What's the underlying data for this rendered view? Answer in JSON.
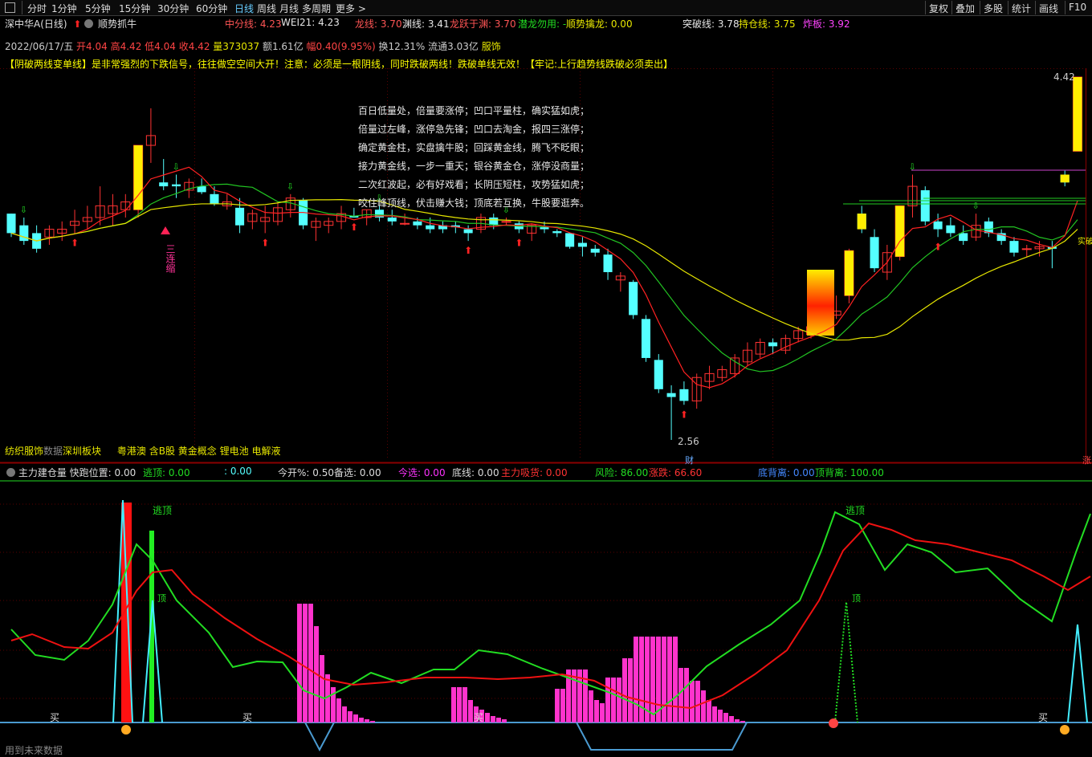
{
  "topbar": {
    "tabs": [
      "分时",
      "1分钟",
      "5分钟",
      "15分钟",
      "30分钟",
      "60分钟",
      "日线",
      "周线",
      "月线",
      "多周期",
      "更多 >"
    ],
    "active_tab": "日线",
    "right_buttons": [
      "复权",
      "叠加",
      "多股",
      "统计",
      "画线",
      "F10"
    ]
  },
  "header": {
    "stock_name": "深中华A(日线)",
    "indicator_name": "顺势抓牛",
    "zhongfen": "中分线: 4.23",
    "wei21": "WEI21: 4.23",
    "longxian": "龙线: 3.70",
    "yuanxian": "渊线: 3.41",
    "longyue": "龙跃于渊: 3.70",
    "qianlong": "潜龙勿用: -",
    "shunshi": "顺势擒龙: 0.00",
    "tupo": "突破线: 3.78",
    "chicang": "持仓线: 3.75",
    "zhaban": "炸板: 3.92"
  },
  "quote": {
    "date": "2022/06/17/五",
    "open": "开4.04",
    "high": "高4.42",
    "low": "低4.04",
    "close": "收4.42",
    "volume": "量373037",
    "amount": "额1.61亿",
    "change": "幅0.40(9.95%)",
    "turnover": "换12.31%",
    "float": "流通3.03亿",
    "industry": "服饰"
  },
  "warning": "【阴破两线变单线】是非常强烈的下跌信号，往往做空空间大开！注意：必须是一根阴线，同时跌破两线！跌破单线无效！【牢记:上行趋势线跌破必须卖出】",
  "poem": [
    "百日低量处，倍量要涨停；凹口平量柱，确实猛如虎；",
    "倍量过左峰，涨停急先锋；凹口去淘金，报四三涨停；",
    "确定黄金柱，实盘擒牛股；回踩黄金线，腾飞不眨眼；",
    "接力黄金线，一步一重天；银谷黄金仓，涨停没商量；",
    "二次红波起，必有好戏看；长阴压短柱，攻势猛如虎；",
    "咬住峰顶线，伏击赚大钱；顶底若互换，牛股要逛奔。"
  ],
  "sectors": {
    "a": "纺织服饰",
    "b": "数据",
    "c": "深圳板块",
    "d": "粤港澳",
    "e": "含B股",
    "f": "黄金概念",
    "g": "锂电池",
    "h": "电解液"
  },
  "labels": {
    "high_price": "4.42",
    "low_price": "2.56",
    "pattern_text": "三连缩",
    "cai": "财",
    "bot_right": "涨",
    "hot_label": "实破"
  },
  "indicator": {
    "name": "主力建仓量",
    "kuaipao": "快跑位置: 0.00",
    "taoding": "逃顶: 0.00",
    "blank": ": 0.00",
    "jinkai": "今开%: 0.50",
    "beixuan": "备选: 0.00",
    "jinxuan": "今选: 0.00",
    "dixian": "底线: 0.00",
    "zhuli": "主力吸货: 0.00",
    "fengxian": "风险: 86.00",
    "zhangdie": "涨跌: 66.60",
    "dibeili": "底背离: 0.00",
    "dingbeili": "顶背离: 100.00",
    "lbl_taoding": "逃顶",
    "lbl_ding": "顶",
    "lbl_mai": "买"
  },
  "footer": "用到未来数据",
  "colors": {
    "up": "#ff3232",
    "down": "#54ffff",
    "ma_yellow": "#e6e600",
    "ma_green": "#22c322",
    "pink": "#ff33cc",
    "kdj_green": "#22dd22",
    "kdj_red": "#ee1111"
  },
  "chart_data": {
    "type": "candlestick",
    "price_range": [
      2.56,
      4.42
    ],
    "candles": [
      {
        "o": 3.72,
        "h": 3.72,
        "l": 3.6,
        "c": 3.62
      },
      {
        "o": 3.66,
        "h": 3.7,
        "l": 3.56,
        "c": 3.58
      },
      {
        "o": 3.62,
        "h": 3.66,
        "l": 3.52,
        "c": 3.54
      },
      {
        "o": 3.6,
        "h": 3.66,
        "l": 3.56,
        "c": 3.64
      },
      {
        "o": 3.62,
        "h": 3.68,
        "l": 3.58,
        "c": 3.64
      },
      {
        "o": 3.66,
        "h": 3.74,
        "l": 3.62,
        "c": 3.68
      },
      {
        "o": 3.68,
        "h": 3.76,
        "l": 3.64,
        "c": 3.7
      },
      {
        "o": 3.7,
        "h": 3.86,
        "l": 3.66,
        "c": 3.76
      },
      {
        "o": 3.72,
        "h": 3.82,
        "l": 3.66,
        "c": 3.76
      },
      {
        "o": 3.74,
        "h": 3.82,
        "l": 3.7,
        "c": 3.78
      },
      {
        "o": 3.74,
        "h": 4.07,
        "l": 3.7,
        "c": 4.07
      },
      {
        "o": 4.07,
        "h": 4.26,
        "l": 3.98,
        "c": 4.12
      },
      {
        "o": 3.88,
        "h": 4.0,
        "l": 3.84,
        "c": 3.86
      },
      {
        "o": 3.87,
        "h": 3.92,
        "l": 3.8,
        "c": 3.86
      },
      {
        "o": 3.84,
        "h": 3.9,
        "l": 3.8,
        "c": 3.88
      },
      {
        "o": 3.86,
        "h": 3.9,
        "l": 3.82,
        "c": 3.83
      },
      {
        "o": 3.82,
        "h": 3.86,
        "l": 3.76,
        "c": 3.77
      },
      {
        "o": 3.76,
        "h": 3.82,
        "l": 3.74,
        "c": 3.78
      },
      {
        "o": 3.75,
        "h": 3.8,
        "l": 3.62,
        "c": 3.66
      },
      {
        "o": 3.68,
        "h": 3.74,
        "l": 3.64,
        "c": 3.72
      },
      {
        "o": 3.68,
        "h": 3.76,
        "l": 3.62,
        "c": 3.7
      },
      {
        "o": 3.68,
        "h": 3.78,
        "l": 3.66,
        "c": 3.75
      },
      {
        "o": 3.74,
        "h": 3.82,
        "l": 3.7,
        "c": 3.8
      },
      {
        "o": 3.79,
        "h": 3.8,
        "l": 3.64,
        "c": 3.66
      },
      {
        "o": 3.65,
        "h": 3.7,
        "l": 3.58,
        "c": 3.68
      },
      {
        "o": 3.66,
        "h": 3.7,
        "l": 3.62,
        "c": 3.68
      },
      {
        "o": 3.68,
        "h": 3.76,
        "l": 3.64,
        "c": 3.72
      },
      {
        "o": 3.71,
        "h": 3.75,
        "l": 3.7,
        "c": 3.7
      },
      {
        "o": 3.7,
        "h": 3.74,
        "l": 3.66,
        "c": 3.74
      },
      {
        "o": 3.74,
        "h": 3.76,
        "l": 3.68,
        "c": 3.7
      },
      {
        "o": 3.7,
        "h": 3.74,
        "l": 3.66,
        "c": 3.68
      },
      {
        "o": 3.67,
        "h": 3.72,
        "l": 3.66,
        "c": 3.67
      },
      {
        "o": 3.68,
        "h": 3.7,
        "l": 3.64,
        "c": 3.66
      },
      {
        "o": 3.66,
        "h": 3.7,
        "l": 3.62,
        "c": 3.64
      },
      {
        "o": 3.66,
        "h": 3.68,
        "l": 3.62,
        "c": 3.64
      },
      {
        "o": 3.66,
        "h": 3.68,
        "l": 3.62,
        "c": 3.65
      },
      {
        "o": 3.64,
        "h": 3.66,
        "l": 3.58,
        "c": 3.62
      },
      {
        "o": 3.64,
        "h": 3.72,
        "l": 3.62,
        "c": 3.7
      },
      {
        "o": 3.7,
        "h": 3.72,
        "l": 3.64,
        "c": 3.66
      },
      {
        "o": 3.68,
        "h": 3.7,
        "l": 3.66,
        "c": 3.68
      },
      {
        "o": 3.67,
        "h": 3.68,
        "l": 3.62,
        "c": 3.64
      },
      {
        "o": 3.62,
        "h": 3.67,
        "l": 3.58,
        "c": 3.66
      },
      {
        "o": 3.65,
        "h": 3.68,
        "l": 3.62,
        "c": 3.64
      },
      {
        "o": 3.63,
        "h": 3.64,
        "l": 3.6,
        "c": 3.62
      },
      {
        "o": 3.62,
        "h": 3.62,
        "l": 3.54,
        "c": 3.55
      },
      {
        "o": 3.57,
        "h": 3.6,
        "l": 3.5,
        "c": 3.55
      },
      {
        "o": 3.54,
        "h": 3.56,
        "l": 3.5,
        "c": 3.52
      },
      {
        "o": 3.51,
        "h": 3.54,
        "l": 3.38,
        "c": 3.42
      },
      {
        "o": 3.38,
        "h": 3.42,
        "l": 3.32,
        "c": 3.4
      },
      {
        "o": 3.37,
        "h": 3.38,
        "l": 3.18,
        "c": 3.2
      },
      {
        "o": 3.18,
        "h": 3.2,
        "l": 2.96,
        "c": 2.98
      },
      {
        "o": 2.97,
        "h": 3.0,
        "l": 2.8,
        "c": 2.82
      },
      {
        "o": 2.8,
        "h": 2.84,
        "l": 2.56,
        "c": 2.78
      },
      {
        "o": 2.82,
        "h": 2.86,
        "l": 2.74,
        "c": 2.76
      },
      {
        "o": 2.76,
        "h": 2.9,
        "l": 2.72,
        "c": 2.88
      },
      {
        "o": 2.86,
        "h": 2.94,
        "l": 2.82,
        "c": 2.9
      },
      {
        "o": 2.88,
        "h": 2.94,
        "l": 2.86,
        "c": 2.92
      },
      {
        "o": 2.9,
        "h": 3.0,
        "l": 2.88,
        "c": 2.98
      },
      {
        "o": 2.96,
        "h": 3.06,
        "l": 2.94,
        "c": 3.02
      },
      {
        "o": 3.0,
        "h": 3.08,
        "l": 2.98,
        "c": 3.06
      },
      {
        "o": 3.06,
        "h": 3.08,
        "l": 3.0,
        "c": 3.04
      },
      {
        "o": 3.02,
        "h": 3.1,
        "l": 3.0,
        "c": 3.08
      },
      {
        "o": 3.08,
        "h": 3.14,
        "l": 3.06,
        "c": 3.12
      },
      {
        "o": 3.1,
        "h": 3.18,
        "l": 3.08,
        "c": 3.14
      },
      {
        "o": 3.14,
        "h": 3.22,
        "l": 3.12,
        "c": 3.2
      },
      {
        "o": 3.2,
        "h": 3.3,
        "l": 3.18,
        "c": 3.22
      },
      {
        "o": 3.3,
        "h": 3.54,
        "l": 3.26,
        "c": 3.53
      },
      {
        "o": 3.72,
        "h": 3.76,
        "l": 3.62,
        "c": 3.64
      },
      {
        "o": 3.6,
        "h": 3.64,
        "l": 3.42,
        "c": 3.44
      },
      {
        "o": 3.42,
        "h": 3.56,
        "l": 3.38,
        "c": 3.52
      },
      {
        "o": 3.5,
        "h": 3.76,
        "l": 3.48,
        "c": 3.76
      },
      {
        "o": 3.76,
        "h": 3.92,
        "l": 3.7,
        "c": 3.86
      },
      {
        "o": 3.84,
        "h": 3.86,
        "l": 3.66,
        "c": 3.68
      },
      {
        "o": 3.68,
        "h": 3.72,
        "l": 3.6,
        "c": 3.64
      },
      {
        "o": 3.66,
        "h": 3.7,
        "l": 3.6,
        "c": 3.62
      },
      {
        "o": 3.62,
        "h": 3.66,
        "l": 3.56,
        "c": 3.58
      },
      {
        "o": 3.6,
        "h": 3.72,
        "l": 3.58,
        "c": 3.66
      },
      {
        "o": 3.68,
        "h": 3.7,
        "l": 3.6,
        "c": 3.62
      },
      {
        "o": 3.62,
        "h": 3.64,
        "l": 3.56,
        "c": 3.58
      },
      {
        "o": 3.58,
        "h": 3.6,
        "l": 3.5,
        "c": 3.52
      },
      {
        "o": 3.54,
        "h": 3.56,
        "l": 3.5,
        "c": 3.54
      },
      {
        "o": 3.54,
        "h": 3.58,
        "l": 3.5,
        "c": 3.55
      },
      {
        "o": 3.55,
        "h": 3.58,
        "l": 3.44,
        "c": 3.54
      },
      {
        "o": 3.92,
        "h": 3.94,
        "l": 3.86,
        "c": 3.88
      },
      {
        "o": 4.04,
        "h": 4.42,
        "l": 4.04,
        "c": 4.42
      }
    ]
  }
}
